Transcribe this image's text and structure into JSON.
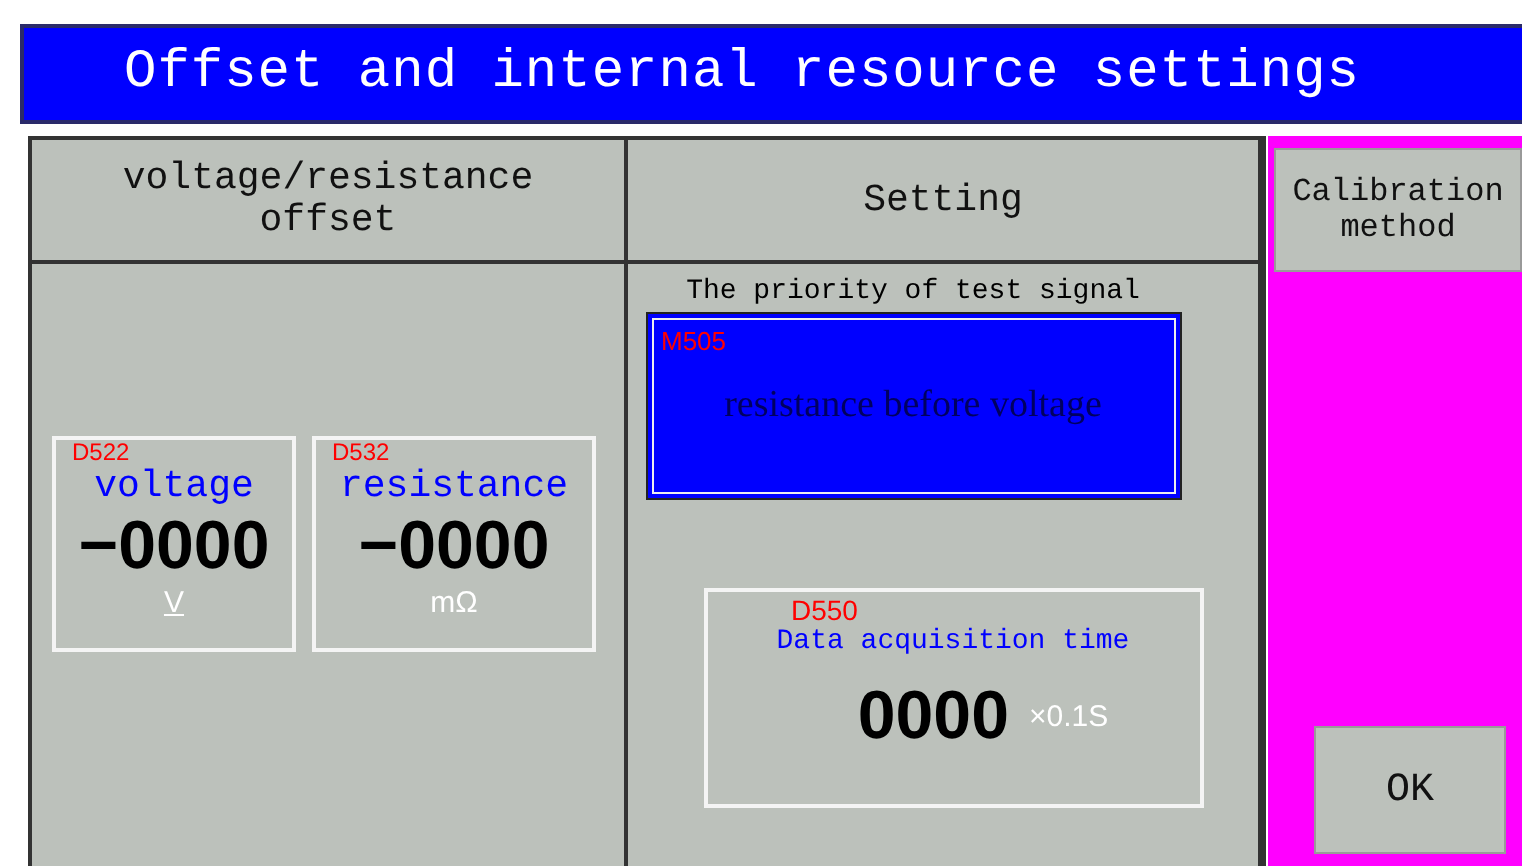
{
  "window": {
    "title": "Offset and internal resource settings"
  },
  "columns": [
    {
      "header": "voltage/resistance offset"
    },
    {
      "header": "Setting"
    }
  ],
  "offsets": [
    {
      "address": "D522",
      "label": "voltage",
      "value": "−0000",
      "unit": "V",
      "unit_underlined": true
    },
    {
      "address": "D532",
      "label": "resistance",
      "value": "−0000",
      "unit": "mΩ",
      "unit_underlined": false
    }
  ],
  "priority": {
    "label": "The priority of test signal",
    "address": "M505",
    "value": "resistance before voltage"
  },
  "acquisition": {
    "address": "D550",
    "label": "Data acquisition time",
    "value": "0000",
    "unit": "×0.1S"
  },
  "side_buttons": [
    {
      "kind": "top",
      "label": "Calibration method"
    },
    {
      "kind": "bottom",
      "label": "OK"
    }
  ]
}
